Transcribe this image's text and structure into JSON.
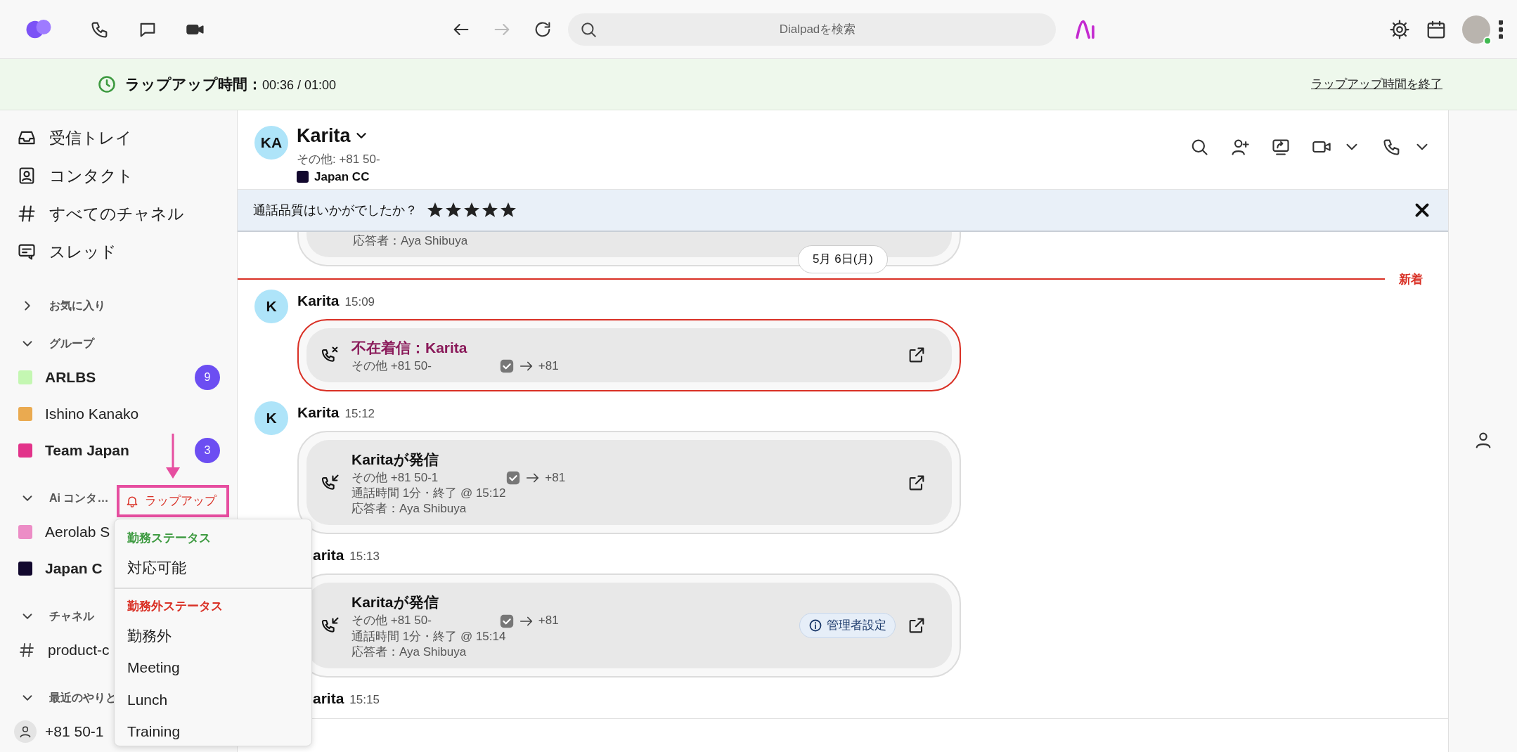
{
  "top_bar": {
    "search": {
      "placeholder": "Dialpadを検索"
    },
    "forward_disabled": true
  },
  "wrapup_bar": {
    "text": "**ラップアップ時間：**00:36 / 01:00",
    "end_link": "ラップアップ時間を終了"
  },
  "sidebar": {
    "nav": [
      {
        "kind": "inbox",
        "label": "受信トレイ"
      },
      {
        "kind": "contacts",
        "label": "コンタクト"
      },
      {
        "kind": "channels",
        "label": "すべてのチャネル"
      },
      {
        "kind": "threads",
        "label": "スレッド"
      }
    ],
    "sections": [
      {
        "title": "お気に入り",
        "expanded": false
      },
      {
        "title": "グループ",
        "expanded": true,
        "items": [
          {
            "kind": "group",
            "label": "ARLBS",
            "color": "#c4f7b2",
            "unread": true,
            "count": "9"
          },
          {
            "kind": "group",
            "label": "Ishino Kanako",
            "color": "#eaaa50",
            "unread": false
          },
          {
            "kind": "group",
            "label": "Team Japan",
            "color": "#e2338a",
            "unread": true,
            "count": "3"
          }
        ]
      },
      {
        "title": "Ai コンタ…",
        "expanded": true,
        "items": [
          {
            "kind": "group",
            "label": "Aerolab S",
            "color": "#ec8dc6",
            "unread": false
          },
          {
            "kind": "group",
            "label": "Japan C",
            "color": "#12082e",
            "unread": true
          }
        ]
      },
      {
        "title": "チャネル",
        "expanded": true,
        "items": [
          {
            "kind": "channel",
            "label": "product-c",
            "unread": false
          }
        ]
      },
      {
        "title": "最近のやりと",
        "expanded": true,
        "items": [
          {
            "kind": "contact",
            "label": "+81 50-1",
            "unread": false
          }
        ]
      }
    ]
  },
  "wrapup_tag": {
    "label": "ラップアップ"
  },
  "status_menu": {
    "sections": [
      {
        "title": "勤務ステータス",
        "color": "#3d9a40",
        "items": [
          "対応可能"
        ]
      },
      {
        "title": "勤務外ステータス",
        "color": "#d93025",
        "items": [
          "勤務外",
          "Meeting",
          "Lunch",
          "Training"
        ]
      }
    ]
  },
  "conversation": {
    "header": {
      "avatar": "KA",
      "name": "Karita",
      "subtitle": "その他: +81 50-",
      "team": {
        "name": "Japan CC",
        "color": "#12082e"
      }
    },
    "rating": {
      "question": "通話品質はいかがでしたか？",
      "stars": 5
    },
    "timeline": [
      {
        "kind": "call_tail",
        "answered_by": "応答者：Aya Shibuya"
      },
      {
        "kind": "date",
        "label": "5月 6日(月)"
      },
      {
        "kind": "new_divider",
        "label": "新着"
      },
      {
        "kind": "message",
        "avatar": "K",
        "name": "Karita",
        "time": "15:09",
        "card": {
          "missed": true,
          "title": "不在着信：Karita",
          "from": "その他 +81 50-",
          "to": "+81"
        }
      },
      {
        "kind": "message",
        "avatar": "K",
        "name": "Karita",
        "time": "15:12",
        "card": {
          "missed": false,
          "title": "Karitaが発信",
          "from": "その他 +81 50-1",
          "to": "+81",
          "duration": "通話時間 1分・終了 @ 15:12",
          "answered_by": "応答者：Aya Shibuya"
        }
      },
      {
        "kind": "message",
        "name": "arita",
        "time": "15:13",
        "card": {
          "missed": false,
          "title": "Karitaが発信",
          "from": "その他 +81 50-",
          "to": "+81",
          "duration": "通話時間 1分・終了 @ 15:14",
          "answered_by": "応答者：Aya Shibuya",
          "badge": "管理者設定"
        }
      },
      {
        "kind": "message",
        "name": "arita",
        "time": "15:15"
      }
    ]
  }
}
